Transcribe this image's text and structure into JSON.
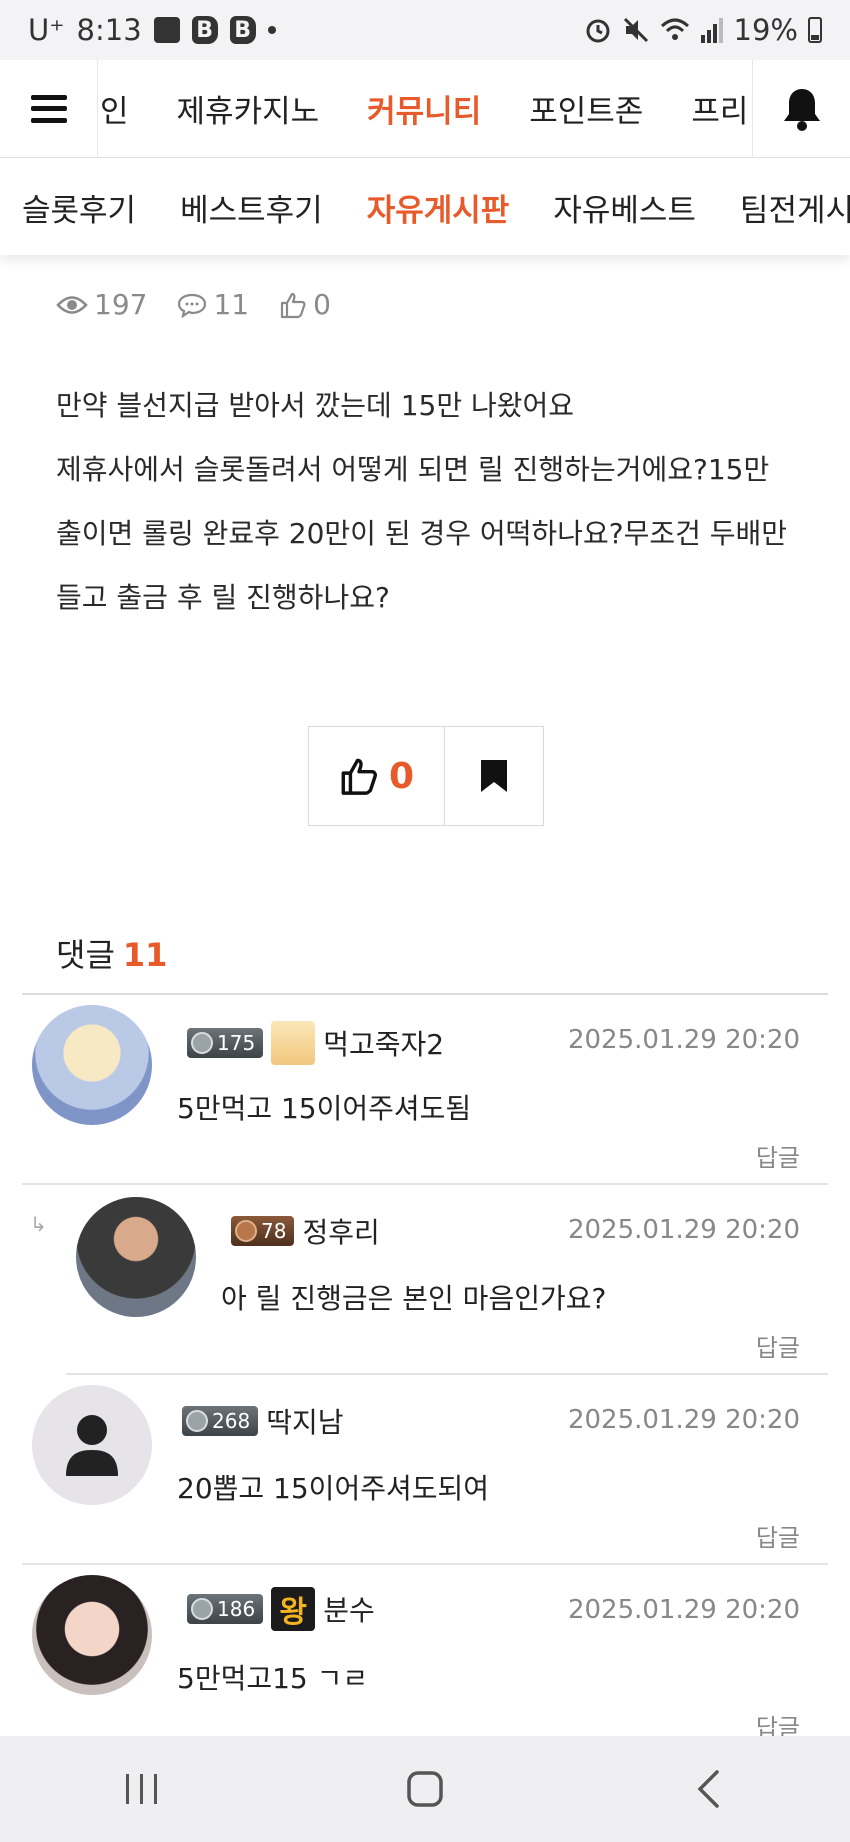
{
  "status_bar": {
    "carrier": "U⁺",
    "time": "8:13",
    "battery": "19%"
  },
  "top_nav": {
    "items": [
      {
        "label": "인",
        "active": false
      },
      {
        "label": "제휴카지노",
        "active": false
      },
      {
        "label": "커뮤니티",
        "active": true
      },
      {
        "label": "포인트존",
        "active": false
      },
      {
        "label": "프리",
        "active": false
      }
    ]
  },
  "sub_nav": {
    "items": [
      {
        "label": "슬롯후기",
        "active": false
      },
      {
        "label": "베스트후기",
        "active": false
      },
      {
        "label": "자유게시판",
        "active": true
      },
      {
        "label": "자유베스트",
        "active": false
      },
      {
        "label": "팀전게시",
        "active": false
      }
    ]
  },
  "post": {
    "views": "197",
    "comments": "11",
    "likes": "0",
    "lines": [
      "만약 블선지급 받아서 깠는데 15만 나왔어요",
      "제휴사에서 슬롯돌려서 어떻게 되면 릴 진행하는거에요?15만",
      "출이면 롤링 완료후 20만이 된 경우 어떡하나요?무조건 두배만",
      "들고 출금 후 릴 진행하나요?"
    ],
    "like_count": "0"
  },
  "comments_header": {
    "label": "댓글",
    "count": "11"
  },
  "comments": [
    {
      "level": "175",
      "nickname": "먹고죽자2",
      "date": "2025.01.29 20:20",
      "text": "5만먹고 15이어주셔도됨",
      "reply_label": "답글"
    },
    {
      "level": "78",
      "nickname": "정후리",
      "date": "2025.01.29 20:20",
      "text": "아 릴 진행금은 본인 마음인가요?",
      "reply_label": "답글"
    },
    {
      "level": "268",
      "nickname": "딱지남",
      "date": "2025.01.29 20:20",
      "text": "20뽑고 15이어주셔도되여",
      "reply_label": "답글"
    },
    {
      "level": "186",
      "nickname": "분수",
      "date": "2025.01.29 20:20",
      "text": "5만먹고15 ㄱㄹ",
      "reply_label": "답글",
      "badge_text": "왕"
    }
  ],
  "colors": {
    "accent": "#e85a2a",
    "muted": "#888888"
  }
}
